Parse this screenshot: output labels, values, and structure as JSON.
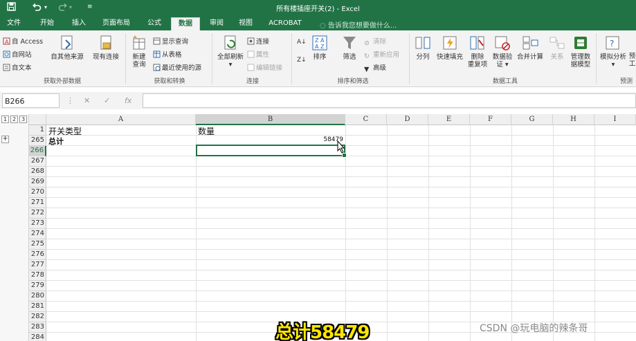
{
  "window": {
    "title": "所有楼插座开关(2) - Excel",
    "undo_icon": "undo-icon",
    "redo_icon": "redo-icon"
  },
  "tabs": [
    "文件",
    "开始",
    "插入",
    "页面布局",
    "公式",
    "数据",
    "审阅",
    "视图",
    "ACROBAT"
  ],
  "active_tab": "数据",
  "tell_me": "告诉我您想要做什么...",
  "ribbon": {
    "get_external": {
      "access": "自 Access",
      "web": "自网站",
      "text": "自文本",
      "other": "自其他来源",
      "existing": "现有连接",
      "label": "获取外部数据"
    },
    "get_transform": {
      "new_query": "新建",
      "new_query2": "查询",
      "show_query": "显示查询",
      "from_table": "从表格",
      "recent": "最近使用的源",
      "label": "获取和转换"
    },
    "connections": {
      "refresh": "全部刷新",
      "conn": "连接",
      "props": "属性",
      "edit_links": "编辑链接",
      "label": "连接"
    },
    "sort_filter": {
      "sort": "排序",
      "filter": "筛选",
      "clear": "清除",
      "reapply": "重新应用",
      "advanced": "高级",
      "label": "排序和筛选"
    },
    "data_tools": {
      "split": "分列",
      "flash": "快速填充",
      "remove_dup1": "删除",
      "remove_dup2": "重复项",
      "validate1": "数据验",
      "validate2": "证",
      "consolidate": "合并计算",
      "relations": "关系",
      "manage1": "管理数",
      "manage2": "据模型",
      "label": "数据工具"
    },
    "forecast": {
      "whatif": "模拟分析",
      "forecast": "预",
      "forecast2": "工",
      "label": "预测"
    }
  },
  "formula_bar": {
    "name_box": "B266",
    "formula": ""
  },
  "outline": {
    "levels": [
      "1",
      "2",
      "3"
    ],
    "expand": "+"
  },
  "columns": [
    "A",
    "B",
    "C",
    "D",
    "E",
    "F",
    "G",
    "H",
    "I"
  ],
  "selected_column": "B",
  "rows": [
    "1",
    "265",
    "266",
    "267",
    "268",
    "269",
    "270",
    "271",
    "272",
    "273",
    "274",
    "275",
    "276",
    "277",
    "278",
    "279",
    "280",
    "281",
    "282",
    "283",
    "284"
  ],
  "selected_row": "266",
  "cells": {
    "A1": "开关类型",
    "B1": "数量",
    "A265": "总计",
    "B265": "58479"
  },
  "overlay": {
    "subtitle": "总计58479",
    "watermark": "CSDN @玩电脑的辣条哥"
  }
}
